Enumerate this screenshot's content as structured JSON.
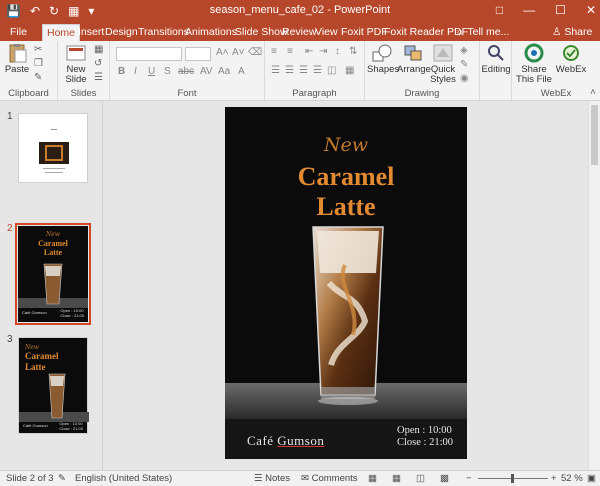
{
  "window": {
    "title": "season_menu_cafe_02 - PowerPoint",
    "minimize_icon": "minimize-icon",
    "restore_icon": "restore-icon",
    "close_icon": "close-icon"
  },
  "tabs": [
    {
      "label": "File",
      "active": false
    },
    {
      "label": "Home",
      "active": true
    },
    {
      "label": "Insert",
      "active": false
    },
    {
      "label": "Design",
      "active": false
    },
    {
      "label": "Transitions",
      "active": false
    },
    {
      "label": "Animations",
      "active": false
    },
    {
      "label": "Slide Show",
      "active": false
    },
    {
      "label": "Review",
      "active": false
    },
    {
      "label": "View",
      "active": false
    },
    {
      "label": "Foxit PDF",
      "active": false
    },
    {
      "label": "Foxit Reader PDF",
      "active": false
    },
    {
      "label": "Tell me...",
      "active": false
    }
  ],
  "share_label": "Share",
  "ribbon": {
    "groups": {
      "clipboard": "Clipboard",
      "slides": "Slides",
      "font": "Font",
      "paragraph": "Paragraph",
      "drawing": "Drawing",
      "webex": "WebEx"
    },
    "buttons": {
      "paste": "Paste",
      "new_slide": "New Slide",
      "shapes": "Shapes",
      "arrange": "Arrange",
      "quick_styles": "Quick Styles",
      "editing": "Editing",
      "share_this_file": "Share This File",
      "webex": "WebEx"
    }
  },
  "thumbnails": [
    {
      "number": "1",
      "selected": false
    },
    {
      "number": "2",
      "selected": true
    },
    {
      "number": "3",
      "selected": false
    }
  ],
  "slide": {
    "new_label": "New",
    "headline_line1": "Caramel",
    "headline_line2": "Latte",
    "cafe_prefix": "Café",
    "cafe_name": "Gumson",
    "open_hours": "Open : 10:00",
    "close_hours": "Close : 21:00"
  },
  "thumb_text": {
    "new_label": "New",
    "headline_line1": "Caramel",
    "headline_line2": "Latte"
  },
  "status": {
    "slide_indicator": "Slide 2 of 3",
    "language": "English (United States)",
    "notes": "Notes",
    "comments": "Comments",
    "zoom": "52 %"
  },
  "colors": {
    "accent": "#b7472a",
    "headline": "#e28a32",
    "slide_bg": "#0b0b0b"
  }
}
